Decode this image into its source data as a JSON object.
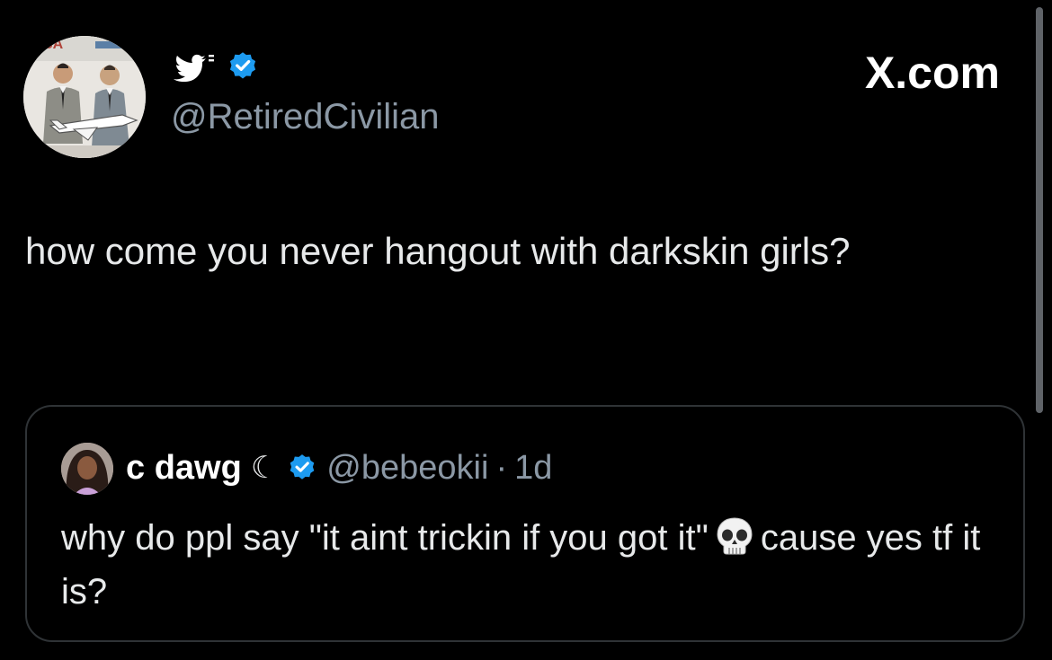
{
  "tweet": {
    "handle": "@RetiredCivilian",
    "site_label": "X.com",
    "text": "how come you never hangout with darkskin girls?"
  },
  "quoted_tweet": {
    "display_name": "c dawg",
    "name_emoji": "☾",
    "handle": "@bebeokii",
    "separator": "·",
    "time": "1d",
    "text_before_emoji": "why do ppl say \"it aint trickin if you got it\"",
    "emoji": "skull",
    "text_after_emoji": "cause yes tf it is?"
  },
  "icons": {
    "bird": "twitter-bird-icon",
    "verified": "verified-badge-icon",
    "moon": "moon-icon",
    "skull": "skull-icon"
  },
  "colors": {
    "background": "#000000",
    "text": "#e7e9ea",
    "secondary_text": "#8b98a5",
    "verified_blue": "#1d9bf0",
    "card_border": "#2f3336"
  }
}
